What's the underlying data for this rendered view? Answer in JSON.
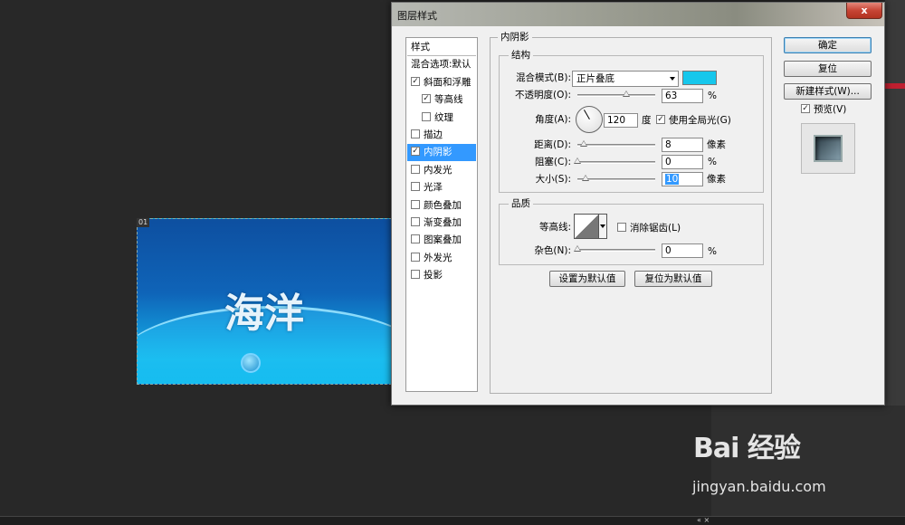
{
  "document": {
    "tab_label": "01",
    "text": "海洋"
  },
  "dialog": {
    "title": "图层样式",
    "close_label": "x",
    "style_list": [
      {
        "label": "样式",
        "checkbox": false,
        "checked": false,
        "selected": false,
        "indent": false
      },
      {
        "label": "混合选项:默认",
        "checkbox": false,
        "checked": false,
        "selected": false,
        "indent": false
      },
      {
        "label": "斜面和浮雕",
        "checkbox": true,
        "checked": true,
        "selected": false,
        "indent": false
      },
      {
        "label": "等高线",
        "checkbox": true,
        "checked": true,
        "selected": false,
        "indent": true
      },
      {
        "label": "纹理",
        "checkbox": true,
        "checked": false,
        "selected": false,
        "indent": true
      },
      {
        "label": "描边",
        "checkbox": true,
        "checked": false,
        "selected": false,
        "indent": false
      },
      {
        "label": "内阴影",
        "checkbox": true,
        "checked": true,
        "selected": true,
        "indent": false
      },
      {
        "label": "内发光",
        "checkbox": true,
        "checked": false,
        "selected": false,
        "indent": false
      },
      {
        "label": "光泽",
        "checkbox": true,
        "checked": false,
        "selected": false,
        "indent": false
      },
      {
        "label": "颜色叠加",
        "checkbox": true,
        "checked": false,
        "selected": false,
        "indent": false
      },
      {
        "label": "渐变叠加",
        "checkbox": true,
        "checked": false,
        "selected": false,
        "indent": false
      },
      {
        "label": "图案叠加",
        "checkbox": true,
        "checked": false,
        "selected": false,
        "indent": false
      },
      {
        "label": "外发光",
        "checkbox": true,
        "checked": false,
        "selected": false,
        "indent": false
      },
      {
        "label": "投影",
        "checkbox": true,
        "checked": false,
        "selected": false,
        "indent": false
      }
    ],
    "section_title": "内阴影",
    "structure": {
      "legend": "结构",
      "blend_mode_label": "混合模式(B):",
      "blend_mode_value": "正片叠底",
      "blend_color": "#16c7ec",
      "opacity_label": "不透明度(O):",
      "opacity_value": "63",
      "opacity_unit": "%",
      "opacity_fraction": 0.63,
      "angle_label": "角度(A):",
      "angle_value": "120",
      "angle_unit": "度",
      "global_light_label": "使用全局光(G)",
      "global_light_checked": true,
      "distance_label": "距离(D):",
      "distance_value": "8",
      "distance_unit": "像素",
      "choke_label": "阻塞(C):",
      "choke_value": "0",
      "choke_unit": "%",
      "size_label": "大小(S):",
      "size_value": "10",
      "size_unit": "像素"
    },
    "quality": {
      "legend": "品质",
      "contour_label": "等高线:",
      "antialias_label": "消除锯齿(L)",
      "antialias_checked": false,
      "noise_label": "杂色(N):",
      "noise_value": "0",
      "noise_unit": "%"
    },
    "buttons": {
      "ok": "确定",
      "reset": "复位",
      "new_style": "新建样式(W)...",
      "preview_label": "预览(V)",
      "preview_checked": true,
      "make_default": "设置为默认值",
      "reset_default": "复位为默认值"
    }
  },
  "watermark": {
    "logo": "Bai 经验",
    "url": "jingyan.baidu.com"
  }
}
